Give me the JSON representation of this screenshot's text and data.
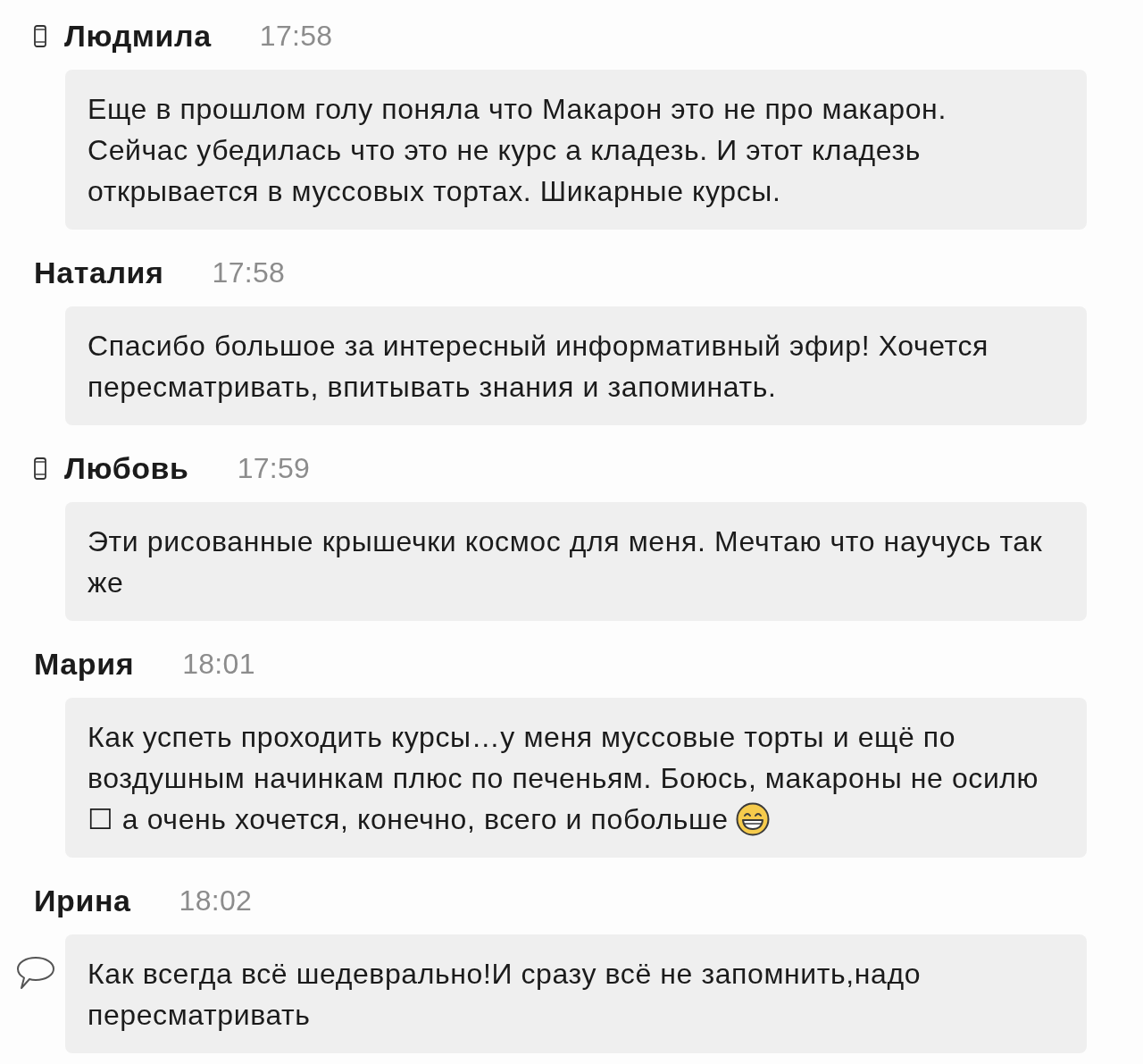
{
  "messages": [
    {
      "author": "Людмила",
      "mobile": true,
      "time": "17:58",
      "text": "Еще в прошлом голу поняла что Макарон это не про макарон. Сейчас убедилась что это не курс а кладезь. И этот кладезь открывается в муссовых тортах. Шикарные курсы."
    },
    {
      "author": "Наталия",
      "time": "17:58",
      "text": "Спасибо большое за интересный информативный эфир! Хочется пересматривать, впитывать знания и запоминать."
    },
    {
      "author": "Любовь",
      "mobile": true,
      "time": "17:59",
      "text": "Эти рисованные крышечки космос для меня. Мечтаю что научусь так же"
    },
    {
      "author": "Мария",
      "time": "18:01",
      "text": "Как успеть проходить курсы…у меня муссовые торты и ещё по воздушным начинкам плюс по печеньям. Боюсь, макароны не осилю ☐ а очень хочется, конечно, всего и побольше",
      "emoji": true
    },
    {
      "author": "Ирина",
      "time": "18:02",
      "text": "Как всегда всё шедеврально!И сразу всё не запомнить,надо пересматривать",
      "comment_icon": true
    }
  ]
}
